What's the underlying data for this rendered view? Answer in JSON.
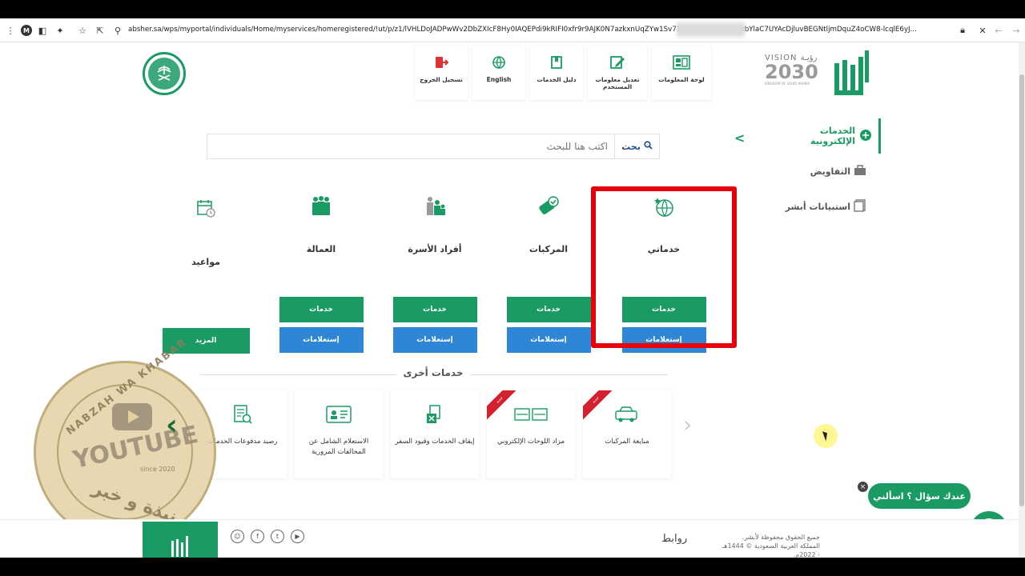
{
  "browser": {
    "url": "absher.sa/wps/myportal/individuals/Home/myservices/homeregistered/!ut/p/z1/lVHLDoJADPwWv2DbZXIcF8Hy0IAQEPdi9kRIFI0xfr9r9AJK0N7azkxnUqZYw1Sv712rb9Z?c2yGSTVakbYlaC7UYAcDjluvBEGNtljmDquZ4oCW8-lcqlE6yJ..."
  },
  "header": {
    "actions": [
      {
        "label": "تسجيل الخروج",
        "icon": "logout-icon"
      },
      {
        "label": "English",
        "icon": "globe-icon"
      },
      {
        "label": "دليل الخدمات",
        "icon": "book-icon"
      },
      {
        "label": "تعديل معلومات المستخدم",
        "icon": "edit-icon"
      },
      {
        "label": "لوحة المعلومات",
        "icon": "dashboard-icon"
      }
    ],
    "vision_text": "VISION",
    "vision_year": "2030",
    "vision_arabic": "رؤيـة",
    "vision_sub": "KINGDOM OF SAUDI ARABIA"
  },
  "sidebar": {
    "items": [
      {
        "label": "الخدمات الإلكترونية",
        "icon": "e-services-icon",
        "active": true
      },
      {
        "label": "التفاويض",
        "icon": "briefcase-icon",
        "active": false
      },
      {
        "label": "استبيانات أبشر",
        "icon": "survey-icon",
        "active": false
      }
    ]
  },
  "search": {
    "button_label": "بحث",
    "placeholder": "اكتب هنا للبحث"
  },
  "cards": [
    {
      "title": "خدماتي",
      "icon": "globe-star-icon",
      "primary": "خدمات",
      "secondary": "إستعلامات"
    },
    {
      "title": "المركبات",
      "icon": "vehicle-check-icon",
      "primary": "خدمات",
      "secondary": "إستعلامات"
    },
    {
      "title": "أفراد الأسرة",
      "icon": "family-icon",
      "primary": "خدمات",
      "secondary": "إستعلامات"
    },
    {
      "title": "العمالة",
      "icon": "workers-icon",
      "primary": "خدمات",
      "secondary": "إستعلامات"
    },
    {
      "title": "مواعيد",
      "icon": "calendar-icon",
      "primary": "المزيد",
      "secondary": ""
    }
  ],
  "other_services": {
    "title": "خدمات أخرى",
    "items": [
      {
        "label": "مبايعة المركبات",
        "icon": "vehicle-sale-icon",
        "ribbon": "جديد"
      },
      {
        "label": "مزاد اللوحات الإلكتروني",
        "icon": "plates-icon",
        "ribbon": "جديد"
      },
      {
        "label": "إيقاف الخدمات وقيود السفر",
        "icon": "stop-services-icon",
        "ribbon": ""
      },
      {
        "label": "الاستعلام الشامل عن المخالفات المرورية",
        "icon": "id-card-icon",
        "ribbon": ""
      },
      {
        "label": "رصيد مدفوعات الخدمات",
        "icon": "receipt-icon",
        "ribbon": ""
      }
    ]
  },
  "watermark": {
    "ring_text": "NABZAH WA KHABAR",
    "main": "YOUTUBE",
    "since": "since 2020",
    "arabic": "نبذة و خبر"
  },
  "chat": {
    "label": "عندك سؤال ؟ اسألني",
    "close": "×"
  },
  "footer": {
    "links_title": "روابط",
    "copyright": "جميع الحقوق محفوظة لأبشر. المملكة العربية السعودية © 1444هـ - 2022م."
  },
  "colors": {
    "green": "#1a9b64",
    "blue": "#2f86d6",
    "highlight_red": "#e8000b"
  }
}
